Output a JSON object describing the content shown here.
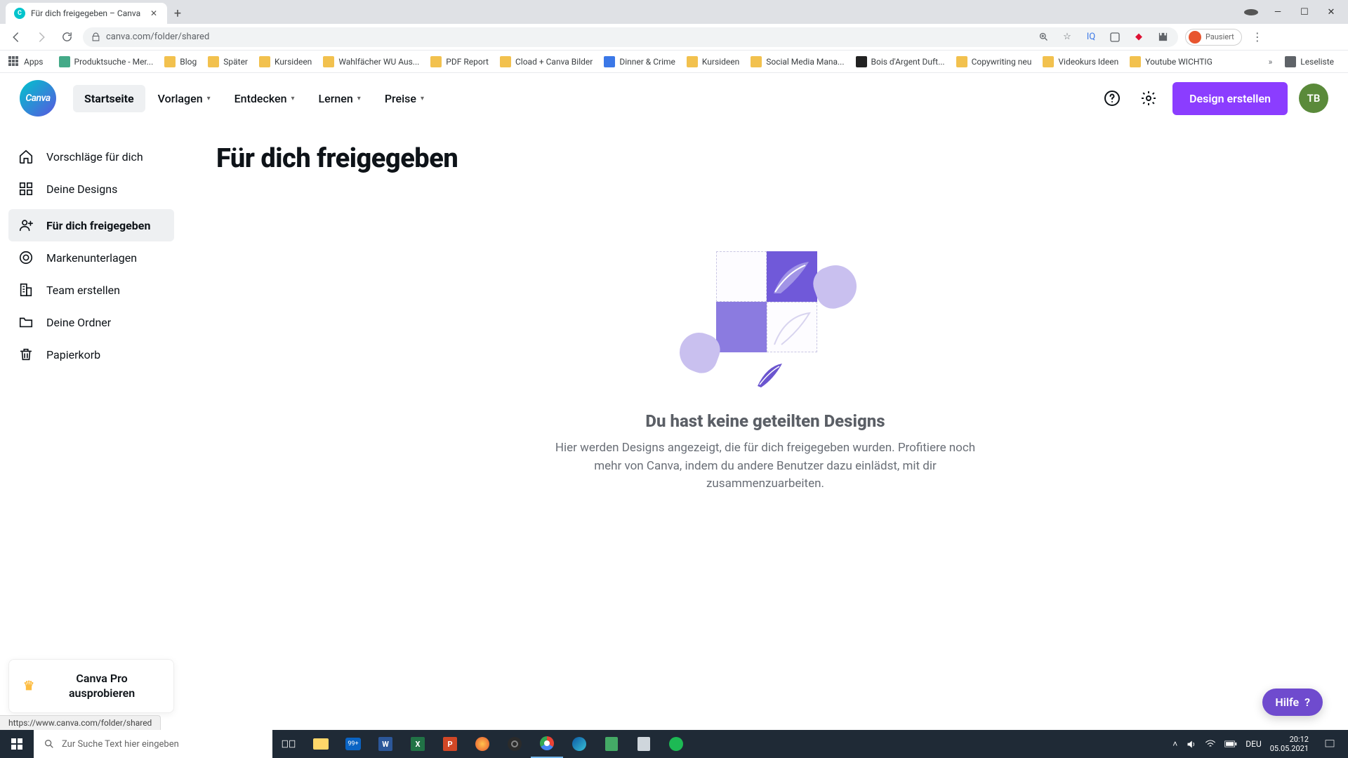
{
  "browser": {
    "tab_title": "Für dich freigegeben – Canva",
    "url": "canva.com/folder/shared",
    "apps_label": "Apps",
    "bookmarks": [
      {
        "label": "Produktsuche - Mer...",
        "color": "#4a8"
      },
      {
        "label": "Blog",
        "color": "#f2c14e"
      },
      {
        "label": "Später",
        "color": "#f2c14e"
      },
      {
        "label": "Kursideen",
        "color": "#f2c14e"
      },
      {
        "label": "Wahlfächer WU Aus...",
        "color": "#f2c14e"
      },
      {
        "label": "PDF Report",
        "color": "#f2c14e"
      },
      {
        "label": "Cload + Canva Bilder",
        "color": "#f2c14e"
      },
      {
        "label": "Dinner & Crime",
        "color": "#3b78e7"
      },
      {
        "label": "Kursideen",
        "color": "#f2c14e"
      },
      {
        "label": "Social Media Mana...",
        "color": "#f2c14e"
      },
      {
        "label": "Bois d'Argent Duft...",
        "color": "#222"
      },
      {
        "label": "Copywriting neu",
        "color": "#f2c14e"
      },
      {
        "label": "Videokurs Ideen",
        "color": "#f2c14e"
      },
      {
        "label": "Youtube WICHTIG",
        "color": "#f2c14e"
      }
    ],
    "reading_list": "Leseliste",
    "pause_label": "Pausiert"
  },
  "nav": {
    "home": "Startseite",
    "templates": "Vorlagen",
    "discover": "Entdecken",
    "learn": "Lernen",
    "pricing": "Preise"
  },
  "actions": {
    "create_design": "Design erstellen",
    "avatar_initials": "TB"
  },
  "sidebar": {
    "items": [
      {
        "label": "Vorschläge für dich"
      },
      {
        "label": "Deine Designs"
      },
      {
        "label": "Für dich freigegeben"
      },
      {
        "label": "Markenunterlagen"
      },
      {
        "label": "Team erstellen"
      },
      {
        "label": "Deine Ordner"
      },
      {
        "label": "Papierkorb"
      }
    ],
    "pro_cta": "Canva Pro ausprobieren"
  },
  "page": {
    "title": "Für dich freigegeben",
    "empty_heading": "Du hast keine geteilten Designs",
    "empty_body": "Hier werden Designs angezeigt, die für dich freigegeben wurden. Profitiere noch mehr von Canva, indem du andere Benutzer dazu einlädst, mit dir zusammenzuarbeiten.",
    "status_url": "https://www.canva.com/folder/shared",
    "help_label": "Hilfe"
  },
  "taskbar": {
    "search_placeholder": "Zur Suche Text hier eingeben",
    "lang": "DEU",
    "time": "20:12",
    "date": "05.05.2021"
  },
  "colors": {
    "accent": "#8b3dff",
    "canva_teal": "#00c4cc",
    "help": "#6f4bce"
  }
}
